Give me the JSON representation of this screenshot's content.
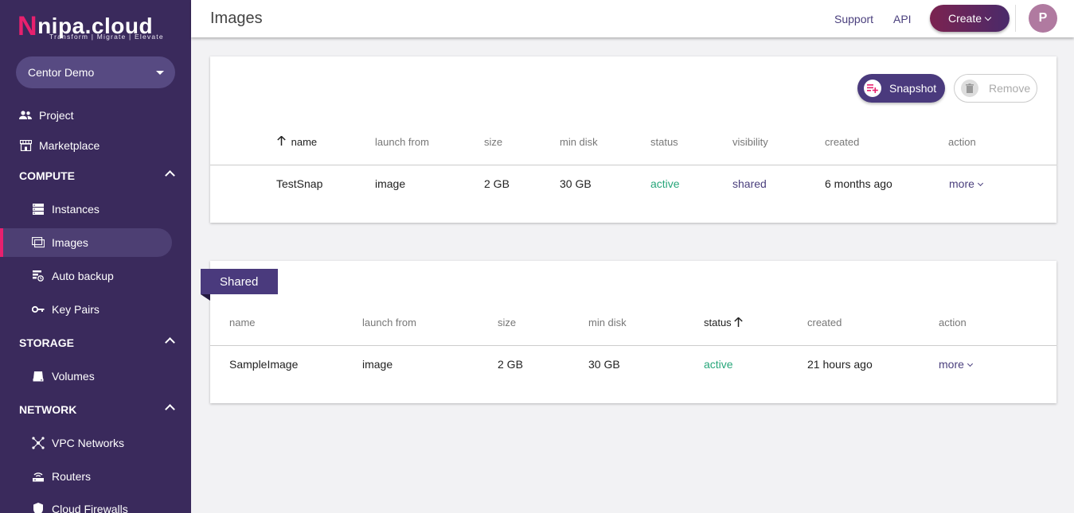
{
  "logo": {
    "text": "nipa.cloud",
    "first_letter": "N",
    "rest": "nipa.cloud",
    "tagline": "Transform | Migrate | Elevate"
  },
  "project_select": {
    "value": "Centor Demo"
  },
  "sidebar": {
    "project": "Project",
    "marketplace": "Marketplace",
    "sections": {
      "compute": "COMPUTE",
      "storage": "STORAGE",
      "network": "NETWORK"
    },
    "compute_items": [
      "Instances",
      "Images",
      "Auto backup",
      "Key Pairs"
    ],
    "storage_items": [
      "Volumes"
    ],
    "network_items": [
      "VPC Networks",
      "Routers",
      "Cloud Firewalls"
    ]
  },
  "header": {
    "title": "Images",
    "support": "Support",
    "api": "API",
    "create": "Create",
    "avatar_initial": "P"
  },
  "snapshots": {
    "snapshot_button": "Snapshot",
    "remove_button": "Remove",
    "columns": [
      "name",
      "launch from",
      "size",
      "min disk",
      "status",
      "visibility",
      "created",
      "action"
    ],
    "rows": [
      {
        "name": "TestSnap",
        "launch_from": "image",
        "size": "2 GB",
        "min_disk": "30 GB",
        "status": "active",
        "visibility": "shared",
        "created": "6 months ago",
        "action": "more"
      }
    ]
  },
  "shared": {
    "ribbon": "Shared",
    "columns": [
      "name",
      "launch from",
      "size",
      "min disk",
      "status",
      "created",
      "action"
    ],
    "rows": [
      {
        "name": "SampleImage",
        "launch_from": "image",
        "size": "2 GB",
        "min_disk": "30 GB",
        "status": "active",
        "created": "21 hours ago",
        "action": "more"
      }
    ]
  },
  "colors": {
    "sidebar_bg": "#3a2a5c",
    "accent_pink": "#e8206e",
    "brand_purple": "#4a3a7d",
    "status_green": "#27a67a"
  }
}
